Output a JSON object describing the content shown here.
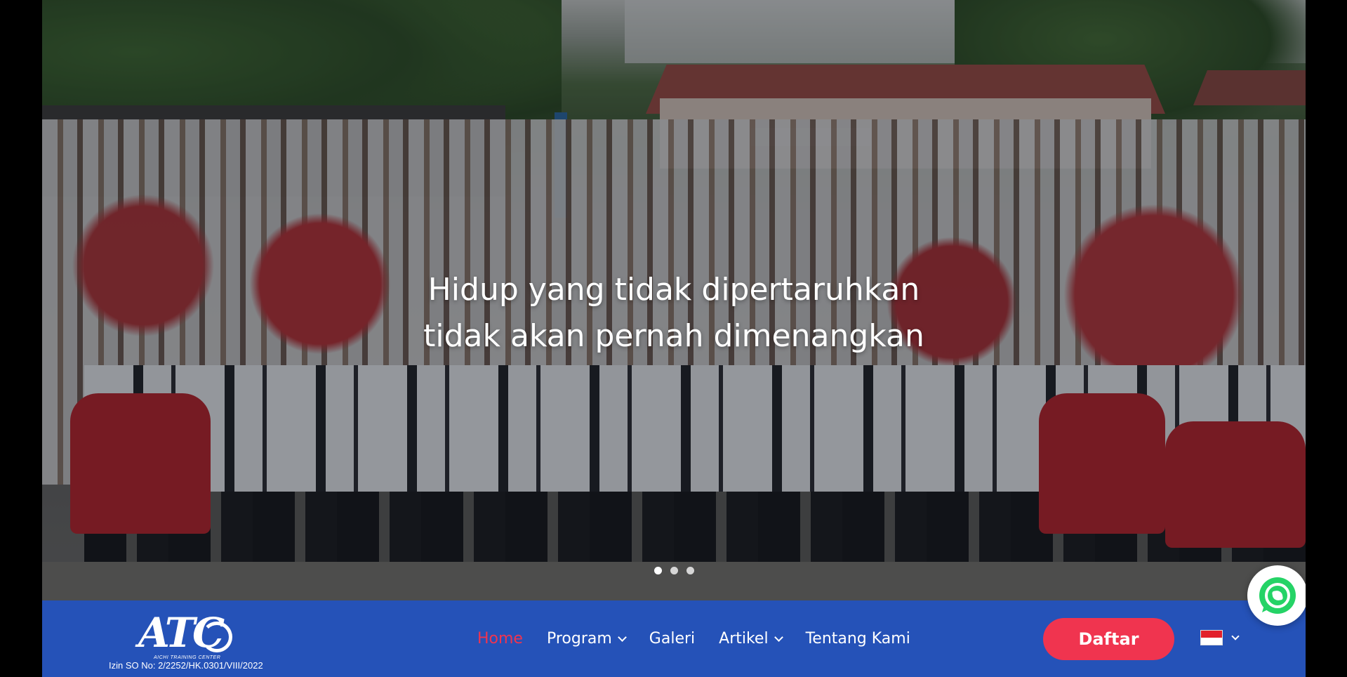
{
  "hero": {
    "caption_line1": "Hidup yang tidak dipertaruhkan",
    "caption_line2": "tidak akan pernah dimenangkan",
    "slides": 3,
    "active_slide": 1,
    "building_sign": "AICHI TRAINING CENTER"
  },
  "brand": {
    "logo_text": "ATC",
    "logo_subtitle": "AICHI TRAINING CENTER",
    "license": "Izin SO No: 2/2252/HK.0301/VIII/2022"
  },
  "nav": {
    "items": [
      {
        "label": "Home",
        "active": true,
        "dropdown": false
      },
      {
        "label": "Program",
        "active": false,
        "dropdown": true
      },
      {
        "label": "Galeri",
        "active": false,
        "dropdown": false
      },
      {
        "label": "Artikel",
        "active": false,
        "dropdown": true
      },
      {
        "label": "Tentang Kami",
        "active": false,
        "dropdown": false
      }
    ],
    "cta_label": "Daftar",
    "language_icon": "flag-indonesia-icon"
  },
  "colors": {
    "navbar": "#2552b8",
    "accent": "#f0344f",
    "whatsapp": "#25d366"
  },
  "floating": {
    "icon": "whatsapp-icon"
  }
}
